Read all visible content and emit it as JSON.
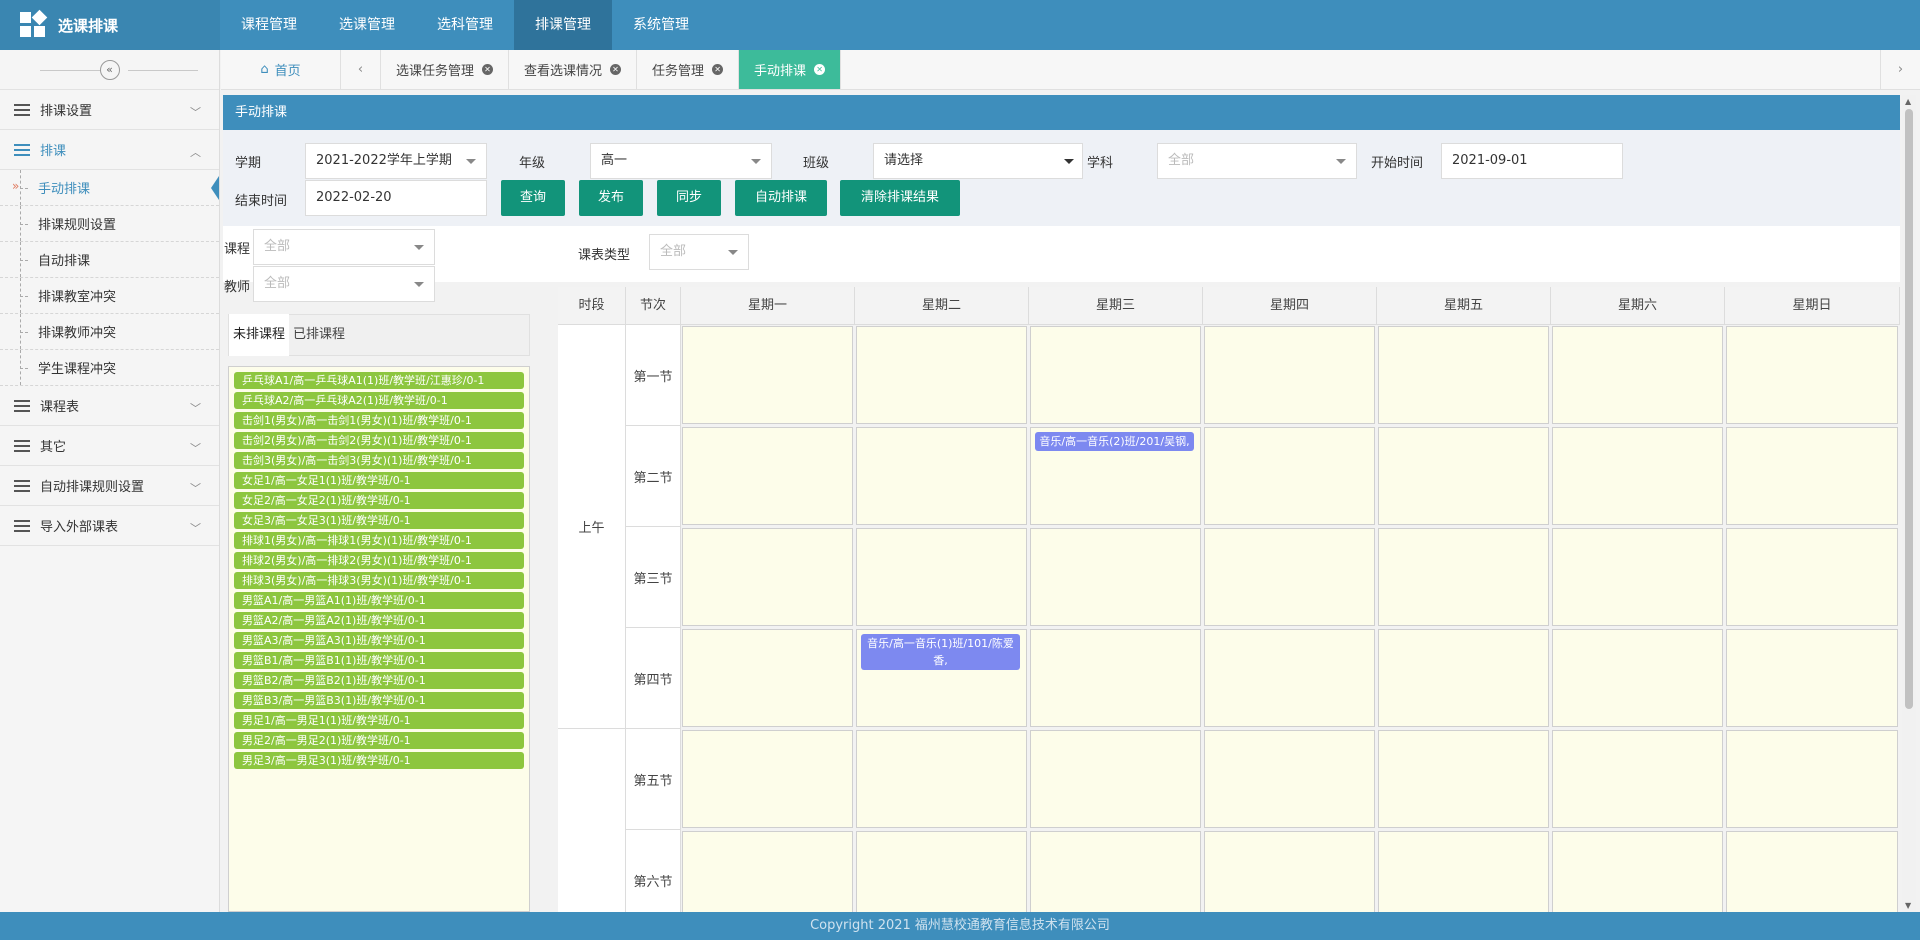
{
  "app": {
    "title": "选课排课",
    "icon": "grid-logo-icon"
  },
  "topnav": [
    "课程管理",
    "选课管理",
    "选科管理",
    "排课管理",
    "系统管理"
  ],
  "topnav_active": "排课管理",
  "sidebar": {
    "collapse_icon": "double-chevron-left-icon",
    "groups": [
      {
        "label": "排课设置",
        "open": false
      },
      {
        "label": "排课",
        "open": true
      }
    ],
    "sub_items": [
      "手动排课",
      "排课规则设置",
      "自动排课",
      "排课教室冲突",
      "排课教师冲突",
      "学生课程冲突"
    ],
    "groups_after": [
      "课程表",
      "其它",
      "自动排课规则设置",
      "导入外部课表"
    ]
  },
  "tabs": {
    "home": "首页",
    "items": [
      "选课任务管理",
      "查看选课情况",
      "任务管理",
      "手动排课"
    ],
    "active": "手动排课"
  },
  "panel": {
    "title": "手动排课"
  },
  "filters": {
    "term_label": "学期",
    "term_value": "2021-2022学年上学期",
    "grade_label": "年级",
    "grade_value": "高一",
    "class_label": "班级",
    "class_value": "请选择",
    "subject_label": "学科",
    "subject_value": "全部",
    "start_label": "开始时间",
    "start_value": "2021-09-01",
    "end_label": "结束时间",
    "end_value": "2022-02-20"
  },
  "buttons": [
    "查询",
    "发布",
    "同步",
    "自动排课",
    "清除排课结果"
  ],
  "left_filters": {
    "course_label": "课程",
    "course_value": "全部",
    "teacher_label": "教师",
    "teacher_value": "全部"
  },
  "table_type": {
    "label": "课表类型",
    "value": "全部"
  },
  "course_tabs": [
    "未排课程",
    "已排课程"
  ],
  "course_tab_active": "未排课程",
  "unscheduled_courses": [
    "乒乓球A1/高一乒乓球A1(1)班/教学班/江惠珍/0-1",
    "乒乓球A2/高一乒乓球A2(1)班/教学班/0-1",
    "击剑1(男女)/高一击剑1(男女)(1)班/教学班/0-1",
    "击剑2(男女)/高一击剑2(男女)(1)班/教学班/0-1",
    "击剑3(男女)/高一击剑3(男女)(1)班/教学班/0-1",
    "女足1/高一女足1(1)班/教学班/0-1",
    "女足2/高一女足2(1)班/教学班/0-1",
    "女足3/高一女足3(1)班/教学班/0-1",
    "排球1(男女)/高一排球1(男女)(1)班/教学班/0-1",
    "排球2(男女)/高一排球2(男女)(1)班/教学班/0-1",
    "排球3(男女)/高一排球3(男女)(1)班/教学班/0-1",
    "男篮A1/高一男篮A1(1)班/教学班/0-1",
    "男篮A2/高一男篮A2(1)班/教学班/0-1",
    "男篮A3/高一男篮A3(1)班/教学班/0-1",
    "男篮B1/高一男篮B1(1)班/教学班/0-1",
    "男篮B2/高一男篮B2(1)班/教学班/0-1",
    "男篮B3/高一男篮B3(1)班/教学班/0-1",
    "男足1/高一男足1(1)班/教学班/0-1",
    "男足2/高一男足2(1)班/教学班/0-1",
    "男足3/高一男足3(1)班/教学班/0-1"
  ],
  "timetable": {
    "head": [
      "时段",
      "节次",
      "星期一",
      "星期二",
      "星期三",
      "星期四",
      "星期五",
      "星期六",
      "星期日"
    ],
    "period_morning": "上午",
    "slots": [
      "第一节",
      "第二节",
      "第三节",
      "第四节",
      "第五节",
      "第六节"
    ],
    "scheduled": [
      {
        "slot": 1,
        "day": 2,
        "text": "音乐/高一音乐(2)班/201/吴钢,"
      },
      {
        "slot": 3,
        "day": 1,
        "text": "音乐/高一音乐(1)班/101/陈爱香,"
      }
    ]
  },
  "footer": "Copyright 2021 福州慧校通教育信息技术有限公司",
  "colors": {
    "header": "#3e8ebc",
    "active_tab": "#3dbb9a",
    "button": "#12947a",
    "course_item": "#8dc63f",
    "scheduled_block": "#7d89f0"
  }
}
